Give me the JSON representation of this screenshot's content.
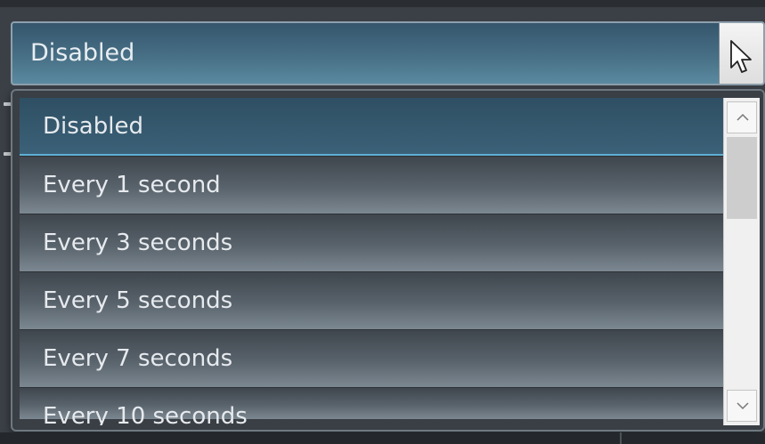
{
  "combo": {
    "selected_value": "Disabled"
  },
  "dropdown": {
    "options": [
      {
        "label": "Disabled",
        "selected": true
      },
      {
        "label": "Every 1 second",
        "selected": false
      },
      {
        "label": "Every 3 seconds",
        "selected": false
      },
      {
        "label": "Every 5 seconds",
        "selected": false
      },
      {
        "label": "Every 7 seconds",
        "selected": false
      },
      {
        "label": "Every 10 seconds",
        "selected": false
      }
    ]
  },
  "icons": {
    "cursor": "mouse-pointer-icon",
    "scroll_up": "chevron-up-icon",
    "scroll_down": "chevron-down-icon"
  },
  "colors": {
    "selection_accent": "#5fb0d6",
    "field_background": "#476f85",
    "item_text": "#e6eaee"
  }
}
